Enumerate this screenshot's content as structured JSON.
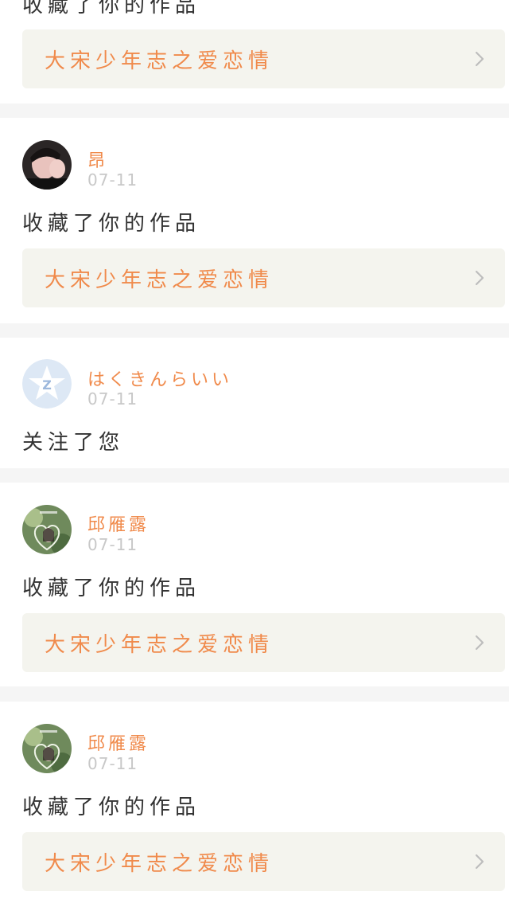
{
  "top_partial": {
    "action": "收藏了你的作品",
    "work_title": "大宋少年志之爱恋情"
  },
  "notifications": [
    {
      "user": "昂",
      "date": "07-11",
      "action": "收藏了你的作品",
      "work_title": "大宋少年志之爱恋情",
      "avatar": "photo-avatar-dark"
    },
    {
      "user": "はくきんらいい",
      "date": "07-11",
      "action": "关注了您",
      "avatar": "default-qq-star-avatar"
    },
    {
      "user": "邱雁露",
      "date": "07-11",
      "action": "收藏了你的作品",
      "work_title": "大宋少年志之爱恋情",
      "avatar": "photo-avatar-green"
    },
    {
      "user": "邱雁露",
      "date": "07-11",
      "action": "收藏了你的作品",
      "work_title": "大宋少年志之爱恋情",
      "avatar": "photo-avatar-green"
    }
  ],
  "colors": {
    "accent": "#f08a4b",
    "date": "#c8c8c8",
    "text": "#333333",
    "link_bg": "#f4f4ee",
    "page_bg": "#f5f5f5"
  }
}
